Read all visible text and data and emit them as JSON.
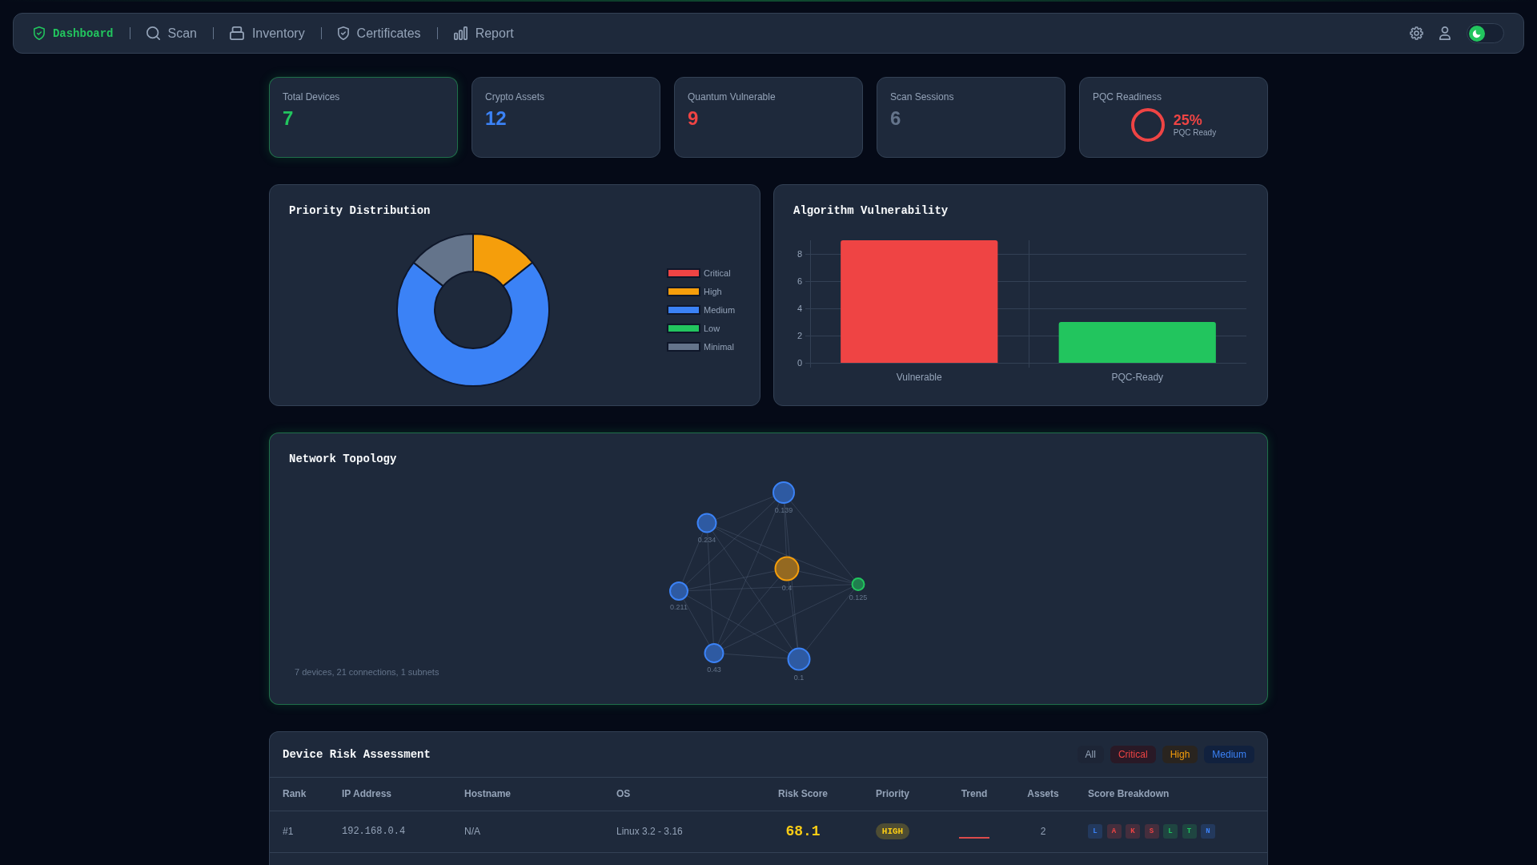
{
  "navbar": {
    "tabs": [
      {
        "label": "Dashboard",
        "selected": true
      },
      {
        "label": "Scan",
        "selected": false
      },
      {
        "label": "Inventory",
        "selected": false
      },
      {
        "label": "Certificates",
        "selected": false
      },
      {
        "label": "Report",
        "selected": false
      }
    ],
    "light_theme": false
  },
  "stats": [
    {
      "kind": "number",
      "label": "Total Devices",
      "value": "7",
      "color": "#22c55e",
      "highlighted": true
    },
    {
      "kind": "number",
      "label": "Crypto Assets",
      "value": "12",
      "color": "#3b82f6",
      "highlighted": false
    },
    {
      "kind": "number",
      "label": "Quantum Vulnerable",
      "value": "9",
      "color": "#ef4444",
      "highlighted": false
    },
    {
      "kind": "number",
      "label": "Scan Sessions",
      "value": "6",
      "color": "#64748b",
      "highlighted": false
    },
    {
      "kind": "ring",
      "label": "PQC Readiness",
      "value": "25%",
      "caption": "PQC Ready",
      "color": "#ef4444",
      "highlighted": false
    }
  ],
  "priority_distribution": {
    "title": "Priority Distribution",
    "chart_data": {
      "type": "donut",
      "categories": [
        "Critical",
        "High",
        "Medium",
        "Low",
        "Minimal"
      ],
      "values": [
        0,
        14.29,
        71.42,
        0,
        14.29
      ],
      "colors": [
        "#ef4444",
        "#f59e0b",
        "#3b82f6",
        "#22c55e",
        "#64748b"
      ]
    }
  },
  "algorithm_vulnerability": {
    "title": "Algorithm Vulnerability",
    "chart_data": {
      "type": "bar",
      "categories": [
        "Vulnerable",
        "PQC-Ready"
      ],
      "values": [
        9,
        3
      ],
      "colors": [
        "#ef4444",
        "#22c55e"
      ],
      "ylim": [
        0,
        9
      ],
      "yticks": [
        0,
        2,
        4,
        6,
        8
      ],
      "grid": true
    }
  },
  "network_topology": {
    "title": "Network Topology",
    "highlighted": true,
    "nodes": [
      {
        "label": "0.139",
        "color": "#3b82f6"
      },
      {
        "label": "0.234",
        "color": "#3b82f6"
      },
      {
        "label": "0.4",
        "color": "#f59e0b"
      },
      {
        "label": "0.211",
        "color": "#3b82f6"
      },
      {
        "label": "0.125",
        "color": "#22c55e"
      },
      {
        "label": "0.43",
        "color": "#3b82f6"
      },
      {
        "label": "0.1",
        "color": "#3b82f6"
      }
    ],
    "summary": "7 devices, 21 connections, 1 subnets"
  },
  "device_risk": {
    "title": "Device Risk Assessment",
    "filters": [
      {
        "label": "All",
        "color": "#94a3b8"
      },
      {
        "label": "Critical",
        "color": "#ef4444"
      },
      {
        "label": "High",
        "color": "#f59e0b"
      },
      {
        "label": "Medium",
        "color": "#3b82f6"
      }
    ],
    "columns": [
      "Rank",
      "IP Address",
      "Hostname",
      "OS",
      "Risk Score",
      "Priority",
      "Trend",
      "Assets",
      "Score Breakdown"
    ],
    "rows": [
      {
        "rank": "#1",
        "ip": "192.168.0.4",
        "hostname": "N/A",
        "os": "Linux 3.2 - 3.16",
        "risk_score": "68.1",
        "priority": {
          "label": "HIGH",
          "color": "#facc15"
        },
        "assets": "2",
        "breakdown": [
          {
            "label": "L",
            "color": "#3b82f6"
          },
          {
            "label": "A",
            "color": "#ef4444"
          },
          {
            "label": "K",
            "color": "#ef4444"
          },
          {
            "label": "S",
            "color": "#ef4444"
          },
          {
            "label": "L",
            "color": "#22c55e"
          },
          {
            "label": "T",
            "color": "#22c55e"
          },
          {
            "label": "N",
            "color": "#3b82f6"
          }
        ]
      }
    ]
  }
}
